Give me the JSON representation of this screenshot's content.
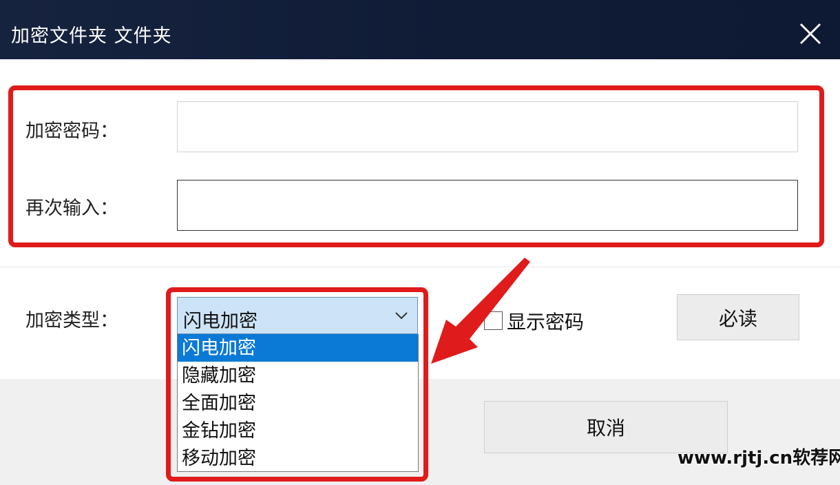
{
  "window": {
    "title": "加密文件夹 文件夹",
    "close_icon": "close-icon"
  },
  "form": {
    "password_label": "加密密码：",
    "password_value": "",
    "confirm_label": "再次输入：",
    "confirm_value": "",
    "type_label": "加密类型：",
    "type_selected": "闪电加密",
    "type_options": [
      "闪电加密",
      "隐藏加密",
      "全面加密",
      "金钻加密",
      "移动加密"
    ],
    "show_password_label": "显示密码",
    "show_password_checked": false
  },
  "buttons": {
    "must_read": "必读",
    "cancel": "取消"
  },
  "watermark": "www.rjtj.cn软荐网",
  "colors": {
    "titlebar": "#101c36",
    "highlight": "#e01b1b",
    "selected_option": "#0b79d6",
    "select_bg": "#cde3f7"
  }
}
